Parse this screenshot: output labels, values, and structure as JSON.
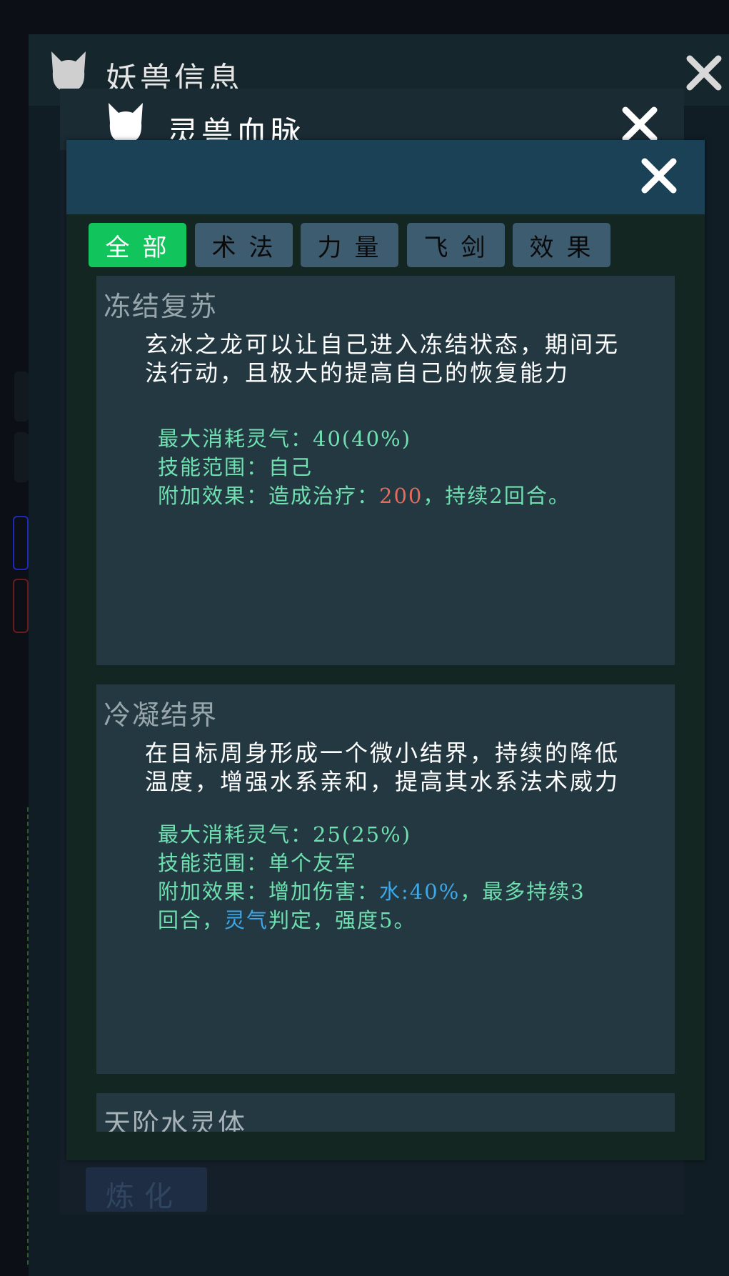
{
  "beast_info_window": {
    "title": "妖兽信息"
  },
  "bloodline_window": {
    "title": "灵兽血脉",
    "refine_label": "炼化"
  },
  "skill_panel": {
    "tabs": [
      {
        "label": "全部",
        "active": true
      },
      {
        "label": "术法",
        "active": false
      },
      {
        "label": "力量",
        "active": false
      },
      {
        "label": "飞剑",
        "active": false
      },
      {
        "label": "效果",
        "active": false
      }
    ],
    "skills": [
      {
        "title": "冻结复苏",
        "description": "玄冰之龙可以让自己进入冻结状态，期间无法行动，且极大的提高自己的恢复能力",
        "max_cost_label": "最大消耗灵气：",
        "max_cost_value": "40(40%)",
        "range_label": "技能范围：",
        "range_value": "自己",
        "effect_label": "附加效果：",
        "effect_prefix": "造成治疗：",
        "effect_highlight": "200",
        "effect_suffix": "，持续2回合。"
      },
      {
        "title": "冷凝结界",
        "description": "在目标周身形成一个微小结界，持续的降低温度，增强水系亲和，提高其水系法术威力",
        "max_cost_label": "最大消耗灵气：",
        "max_cost_value": "25(25%)",
        "range_label": "技能范围：",
        "range_value": "单个友军",
        "effect_label": "附加效果：",
        "effect_prefix": "增加伤害：",
        "effect_highlight": "水:40%",
        "effect_middle": "，最多持续3",
        "effect_line2_highlight": "灵气",
        "effect_line2_prefix": "回合，",
        "effect_line2_suffix": "判定，强度5。"
      },
      {
        "title": "天阶水灵体"
      }
    ]
  },
  "colors": {
    "active_tab": "#11c45c",
    "tab": "#3e5c70",
    "stat_text": "#6fe0b0",
    "heal_value": "#e86a5a",
    "element_value": "#3ca8e8"
  },
  "icons": [
    "cat-icon",
    "close-icon"
  ]
}
